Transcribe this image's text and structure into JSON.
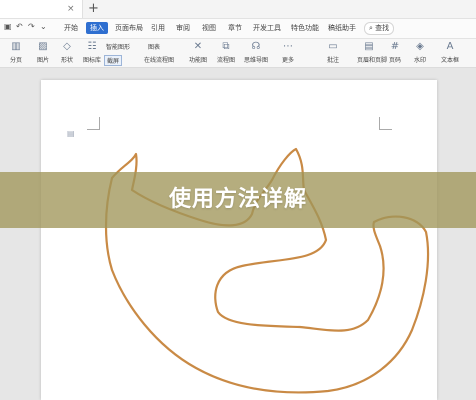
{
  "tabstrip": {
    "close_glyph": "×",
    "new_tab_glyph": "+"
  },
  "quick_access": {
    "icons": [
      "save-icon",
      "undo-icon",
      "redo-icon",
      "more-icon"
    ]
  },
  "menu": {
    "items": [
      "开始",
      "插入",
      "页面布局",
      "引用",
      "审阅",
      "视图",
      "章节",
      "开发工具",
      "特色功能",
      "稿纸助手"
    ],
    "active": "插入",
    "search_label": "查找"
  },
  "ribbon": {
    "big_buttons": [
      "分页",
      "图片",
      "形状",
      "图标库",
      "功能图",
      "流程图",
      "思维导图",
      "更多",
      "批注",
      "页眉和页脚",
      "页码",
      "水印",
      "文本框"
    ],
    "small_buttons": {
      "smartart": "智能图形",
      "chart": "图表",
      "screenshot": "截屏",
      "online_flow": "在线流程图",
      "function": "功能图"
    }
  },
  "document": {
    "marker_icon": "doc-icon"
  },
  "banner": {
    "title": "使用方法详解"
  },
  "colors": {
    "scribble": "#c98a45",
    "banner": "#a0965a",
    "accent": "#2f6fd0"
  }
}
